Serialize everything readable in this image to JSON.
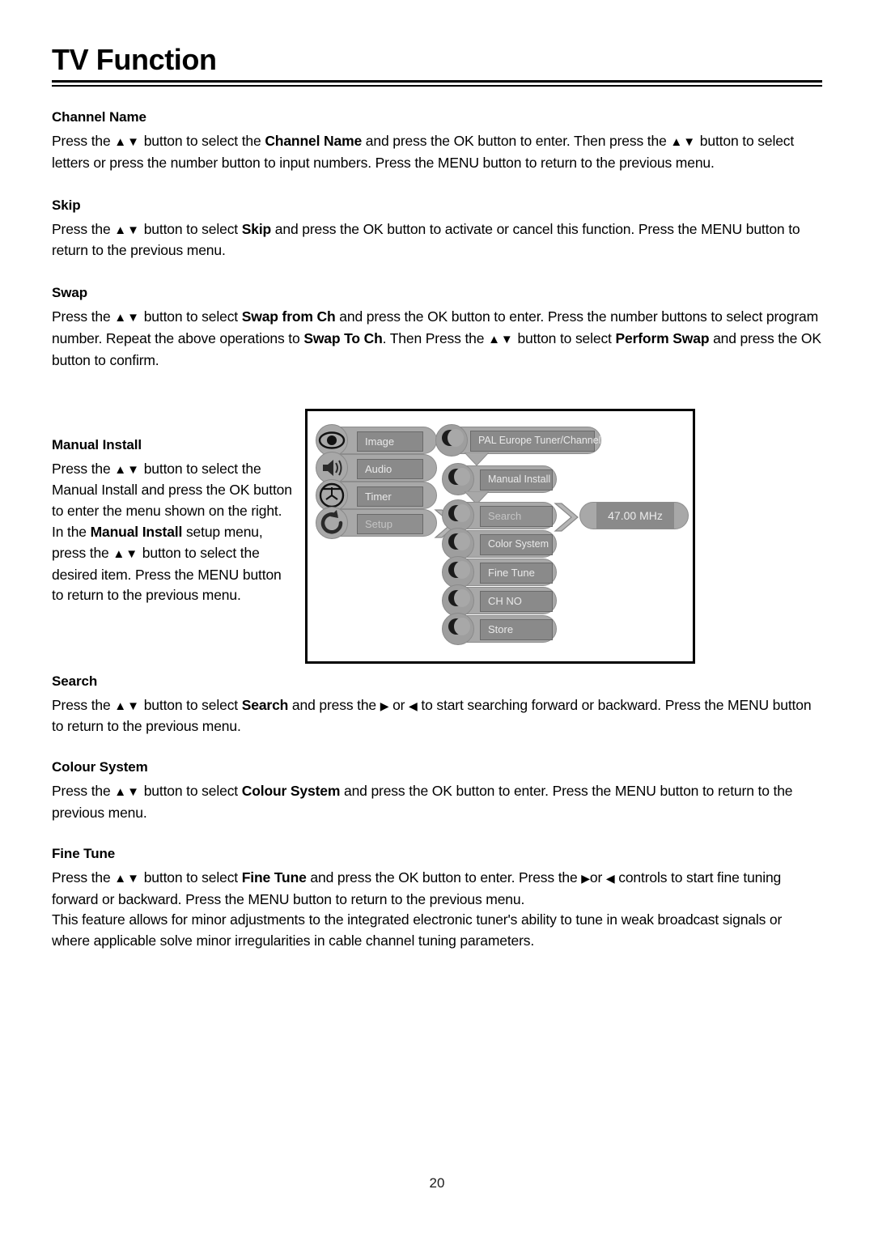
{
  "document": {
    "title": "TV Function",
    "page_number": "20"
  },
  "sections": [
    {
      "heading": "Channel Name",
      "paragraphs": [
        [
          {
            "t": "Press the ",
            "b": false
          },
          {
            "t": "▲▼",
            "b": false,
            "arrow": true
          },
          {
            "t": " button to select the ",
            "b": false
          },
          {
            "t": "Channel Name",
            "b": true
          },
          {
            "t": " and press the OK button to enter. Then press the ",
            "b": false
          },
          {
            "t": "▲▼",
            "b": false,
            "arrow": true
          },
          {
            "t": " button to select letters or press the number button to input numbers. Press the MENU button to return to the previous menu.",
            "b": false
          }
        ]
      ]
    },
    {
      "heading": "Skip",
      "paragraphs": [
        [
          {
            "t": "Press the ",
            "b": false
          },
          {
            "t": "▲▼",
            "b": false,
            "arrow": true
          },
          {
            "t": " button to select ",
            "b": false
          },
          {
            "t": "Skip",
            "b": true
          },
          {
            "t": " and press the OK button to activate or cancel this function. Press the MENU button to return to the previous menu.",
            "b": false
          }
        ]
      ]
    },
    {
      "heading": "Swap",
      "paragraphs": [
        [
          {
            "t": "Press the ",
            "b": false
          },
          {
            "t": "▲▼",
            "b": false,
            "arrow": true
          },
          {
            "t": " button to select ",
            "b": false
          },
          {
            "t": "Swap from Ch",
            "b": true
          },
          {
            "t": " and press the OK button to enter. Press the number buttons to select program number. Repeat the above operations to ",
            "b": false
          },
          {
            "t": "Swap To Ch",
            "b": true
          },
          {
            "t": ". Then Press the ",
            "b": false
          },
          {
            "t": "▲▼",
            "b": false,
            "arrow": true
          },
          {
            "t": " button to select ",
            "b": false
          },
          {
            "t": "Perform Swap",
            "b": true
          },
          {
            "t": " and press the OK button to confirm.",
            "b": false
          }
        ]
      ]
    }
  ],
  "manual_install": {
    "heading": "Manual Install",
    "paragraph_1": [
      {
        "t": "Press the ",
        "b": false
      },
      {
        "t": "▲▼",
        "b": false,
        "arrow": true
      },
      {
        "t": " button to select the Manual Install and press the OK button to enter the menu shown on the right.",
        "b": false
      }
    ],
    "paragraph_2": [
      {
        "t": "In the ",
        "b": false
      },
      {
        "t": "Manual Install",
        "b": true
      },
      {
        "t": " setup menu, press the ",
        "b": false
      },
      {
        "t": "▲▼",
        "b": false,
        "arrow": true
      },
      {
        "t": " button to select the desired item. Press the MENU button to return to the previous menu.",
        "b": false
      }
    ]
  },
  "tv_menu_diagram": {
    "left_column": [
      {
        "label": "Image",
        "icon": "eye-icon",
        "selected": false
      },
      {
        "label": "Audio",
        "icon": "speaker-icon",
        "selected": false
      },
      {
        "label": "Timer",
        "icon": "clock-icon",
        "selected": false
      },
      {
        "label": "Setup",
        "icon": "refresh-icon",
        "selected": true
      }
    ],
    "top_item": {
      "label": "PAL Europe Tuner/Channel",
      "icon": "moon-icon"
    },
    "middle_column": [
      {
        "label": "Manual Install",
        "icon": "moon-icon",
        "selected": false
      },
      {
        "label": "Search",
        "icon": "moon-icon",
        "selected": true
      },
      {
        "label": "Color System",
        "icon": "moon-icon",
        "selected": false
      },
      {
        "label": "Fine Tune",
        "icon": "moon-icon",
        "selected": false
      },
      {
        "label": "CH NO",
        "icon": "moon-icon",
        "selected": false
      },
      {
        "label": "Store",
        "icon": "moon-icon",
        "selected": false
      }
    ],
    "value_box": {
      "label": "47.00 MHz"
    }
  },
  "lower_sections": [
    {
      "heading": "Search",
      "paragraphs": [
        [
          {
            "t": "Press the ",
            "b": false
          },
          {
            "t": "▲▼",
            "b": false,
            "arrow": true
          },
          {
            "t": " button to select ",
            "b": false
          },
          {
            "t": "Search",
            "b": true
          },
          {
            "t": " and press the ",
            "b": false
          },
          {
            "t": "▶",
            "b": false,
            "lr": true
          },
          {
            "t": " or ",
            "b": false
          },
          {
            "t": "◀",
            "b": false,
            "lr": true
          },
          {
            "t": " to start searching forward or backward. Press the MENU button to return to the previous menu.",
            "b": false
          }
        ]
      ]
    },
    {
      "heading": "Colour System",
      "paragraphs": [
        [
          {
            "t": "Press the ",
            "b": false
          },
          {
            "t": "▲▼",
            "b": false,
            "arrow": true
          },
          {
            "t": " button to select ",
            "b": false
          },
          {
            "t": "Colour System",
            "b": true
          },
          {
            "t": " and press the OK button to enter. Press the MENU button to return to the previous menu.",
            "b": false
          }
        ]
      ]
    },
    {
      "heading": "Fine Tune",
      "paragraphs": [
        [
          {
            "t": "Press the ",
            "b": false
          },
          {
            "t": "▲▼",
            "b": false,
            "arrow": true
          },
          {
            "t": " button to select ",
            "b": false
          },
          {
            "t": "Fine Tune",
            "b": true
          },
          {
            "t": " and press the OK button to enter. Press the ",
            "b": false
          },
          {
            "t": "▶",
            "b": false,
            "lr": true
          },
          {
            "t": "or ",
            "b": false
          },
          {
            "t": "◀",
            "b": false,
            "lr": true
          },
          {
            "t": " controls to start fine tuning forward or backward. Press the MENU button to return to the previous menu.",
            "b": false
          }
        ],
        [
          {
            "t": "This feature allows for minor adjustments to the integrated electronic tuner's ability to tune in weak broadcast signals or where applicable solve minor irregularities in cable channel tuning parameters.",
            "b": false
          }
        ]
      ]
    }
  ]
}
